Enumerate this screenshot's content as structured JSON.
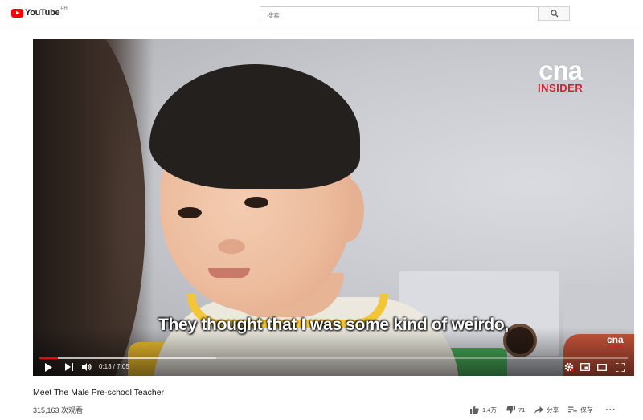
{
  "header": {
    "logo_text": "YouTube",
    "region": "PH",
    "search_placeholder": "搜索",
    "search_icon": "search-icon"
  },
  "player": {
    "watermark": {
      "brand": "cna",
      "sub": "INSIDER"
    },
    "subtitle": "They thought that I was some kind of weirdo,",
    "time_display": "0:13 / 7:05",
    "progress_fraction": 0.031,
    "buffer_fraction": 0.3,
    "icons": [
      "play-icon",
      "next-icon",
      "volume-icon",
      "settings-icon",
      "miniplayer-icon",
      "theater-icon",
      "fullscreen-icon"
    ],
    "accent_color": "#ff0000"
  },
  "video": {
    "title": "Meet The Male Pre-school Teacher",
    "views": "315,163 次观看",
    "like_count": "1.4万",
    "dislike_count": "71",
    "share_label": "分享",
    "save_label": "保存",
    "more_label": "..."
  }
}
